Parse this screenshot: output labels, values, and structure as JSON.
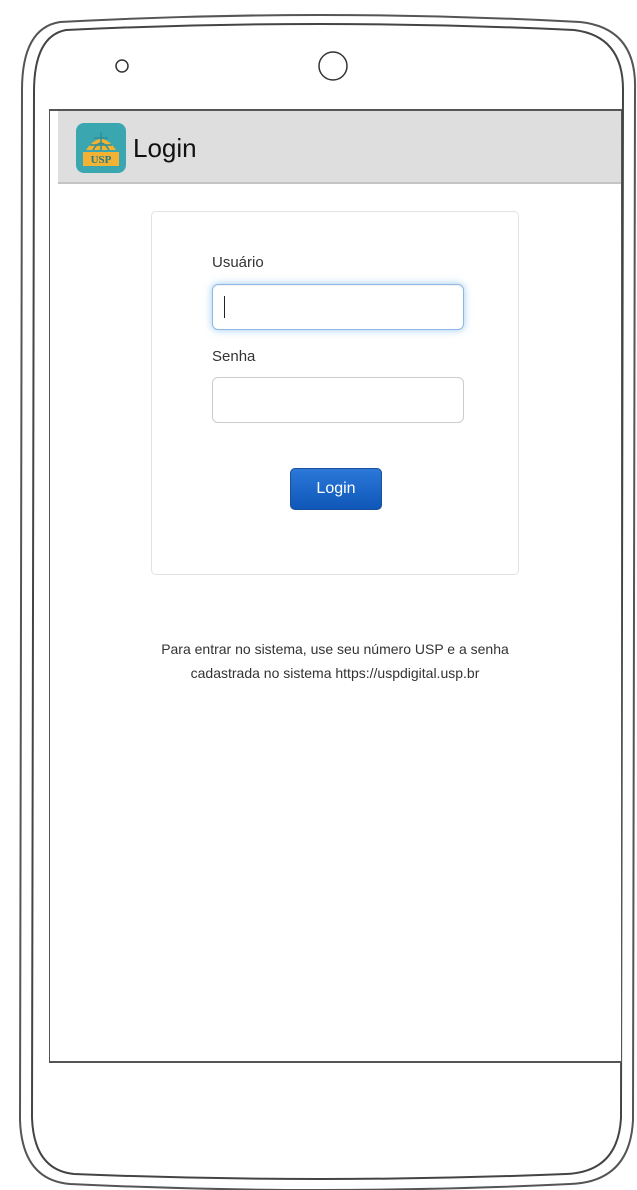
{
  "appbar": {
    "title": "Login",
    "icon": "usp-logo-icon",
    "icon_bg": "#3aa7b0",
    "icon_accent": "#f2b233",
    "background": "#dedede"
  },
  "form": {
    "username_label": "Usuário",
    "username_value": "",
    "password_label": "Senha",
    "password_value": "",
    "login_label": "Login"
  },
  "help": {
    "line1": "Para entrar no sistema, use seu número USP e a senha",
    "line2": "cadastrada no sistema https://uspdigital.usp.br"
  },
  "colors": {
    "button": "#1f6bd0",
    "focus": "#66afe9"
  }
}
